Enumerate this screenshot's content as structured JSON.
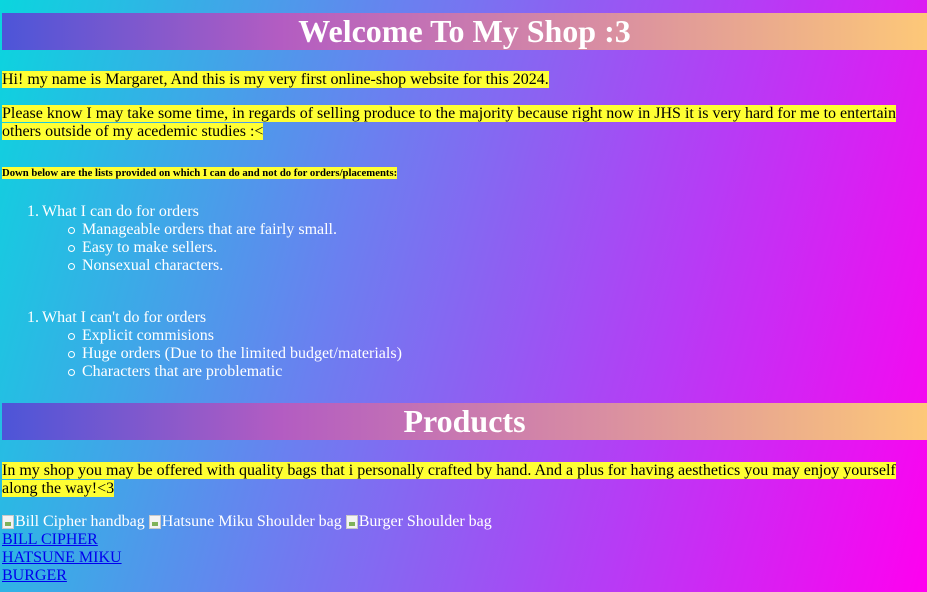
{
  "header": {
    "title": "Welcome To My Shop :3"
  },
  "intro": {
    "greeting": "Hi! my name is Margaret, And this is my very first online-shop website for this 2024.",
    "notice": "Please know I may take some time, in regards of selling produce to the majority because right now in JHS it is very hard for me to entertain others outside of my acedemic studies :<"
  },
  "lists_heading": "Down below are the lists provided on which I can do and not do for orders/placements:",
  "can_do": {
    "number": "1.",
    "title": "What I can do for orders",
    "items": [
      "Manageable orders that are fairly small.",
      "Easy to make sellers.",
      "Nonsexual characters."
    ]
  },
  "cannot_do": {
    "number": "1.",
    "title": "What I can't do for orders",
    "items": [
      "Explicit commisions",
      "Huge orders (Due to the limited budget/materials)",
      "Characters that are problematic"
    ]
  },
  "products": {
    "title": "Products",
    "description": "In my shop you may be offered with quality bags that i personally crafted by hand. And a plus for having aesthetics you may enjoy yourself along the way!<3",
    "images": [
      {
        "alt": "Bill Cipher handbag",
        "icon": "broken-image-icon"
      },
      {
        "alt": "Hatsune Miku Shoulder bag",
        "icon": "broken-image-icon"
      },
      {
        "alt": "Burger Shoulder bag",
        "icon": "broken-image-icon"
      }
    ],
    "links": [
      "BILL CIPHER",
      "HATSUNE MIKU",
      "BURGER"
    ]
  },
  "colors": {
    "highlight": "#ffff33",
    "link": "#0000ee",
    "banner_start": "#4c55d8",
    "banner_end": "#fdc878"
  }
}
